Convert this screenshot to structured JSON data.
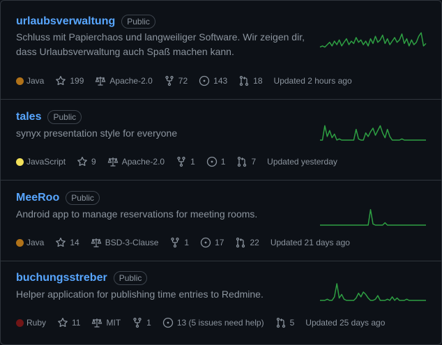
{
  "colors": {
    "link": "#58a6ff",
    "text_muted": "#8b949e",
    "spark": "#2ea043"
  },
  "repos": [
    {
      "name": "urlaubsverwaltung",
      "visibility": "Public",
      "description": "Schluss mit Papierchaos und langweiliger Software. Wir zeigen dir, dass Urlaubsverwaltung auch Spaß machen kann.",
      "language": "Java",
      "language_color": "#b07219",
      "stars": "199",
      "license": "Apache-2.0",
      "forks": "72",
      "issues": "143",
      "pulls": "18",
      "updated": "Updated 2 hours ago",
      "activity": [
        2,
        3,
        2,
        4,
        6,
        3,
        7,
        4,
        8,
        3,
        6,
        9,
        4,
        7,
        5,
        10,
        6,
        8,
        4,
        7,
        3,
        9,
        5,
        11,
        6,
        8,
        12,
        5,
        9,
        4,
        7,
        10,
        6,
        8,
        13,
        5,
        9,
        3,
        8,
        4,
        6,
        11,
        14,
        3,
        5
      ]
    },
    {
      "name": "tales",
      "visibility": "Public",
      "description": "synyx presentation style for everyone",
      "language": "JavaScript",
      "language_color": "#f1e05a",
      "stars": "9",
      "license": "Apache-2.0",
      "forks": "1",
      "issues": "1",
      "pulls": "7",
      "updated": "Updated yesterday",
      "activity": [
        0,
        0,
        12,
        3,
        8,
        2,
        5,
        0,
        1,
        0,
        0,
        0,
        0,
        0,
        0,
        9,
        1,
        0,
        0,
        6,
        3,
        7,
        10,
        4,
        8,
        12,
        6,
        2,
        9,
        3,
        0,
        0,
        0,
        0,
        1,
        0,
        0,
        0,
        0,
        0,
        0,
        0,
        0,
        0,
        0
      ]
    },
    {
      "name": "MeeRoo",
      "visibility": "Public",
      "description": "Android app to manage reservations for meeting rooms.",
      "language": "Java",
      "language_color": "#b07219",
      "stars": "14",
      "license": "BSD-3-Clause",
      "forks": "1",
      "issues": "17",
      "pulls": "22",
      "updated": "Updated 21 days ago",
      "activity": [
        0,
        0,
        0,
        0,
        0,
        0,
        0,
        0,
        0,
        0,
        0,
        0,
        0,
        0,
        0,
        0,
        0,
        0,
        0,
        0,
        0,
        13,
        1,
        0,
        0,
        0,
        0,
        2,
        0,
        0,
        0,
        0,
        0,
        0,
        0,
        0,
        0,
        0,
        0,
        0,
        0,
        0,
        0,
        0,
        0
      ]
    },
    {
      "name": "buchungsstreber",
      "visibility": "Public",
      "description": "Helper application for publishing time entries to Redmine.",
      "language": "Ruby",
      "language_color": "#701516",
      "stars": "11",
      "license": "MIT",
      "forks": "1",
      "issues": "13 (5 issues need help)",
      "pulls": "5",
      "updated": "Updated 25 days ago",
      "activity": [
        0,
        0,
        0,
        1,
        0,
        0,
        3,
        14,
        2,
        5,
        1,
        0,
        0,
        0,
        0,
        2,
        6,
        3,
        7,
        5,
        2,
        0,
        0,
        1,
        4,
        0,
        0,
        0,
        1,
        0,
        3,
        0,
        2,
        0,
        0,
        0,
        1,
        0,
        0,
        0,
        0,
        0,
        0,
        0,
        0
      ]
    }
  ]
}
